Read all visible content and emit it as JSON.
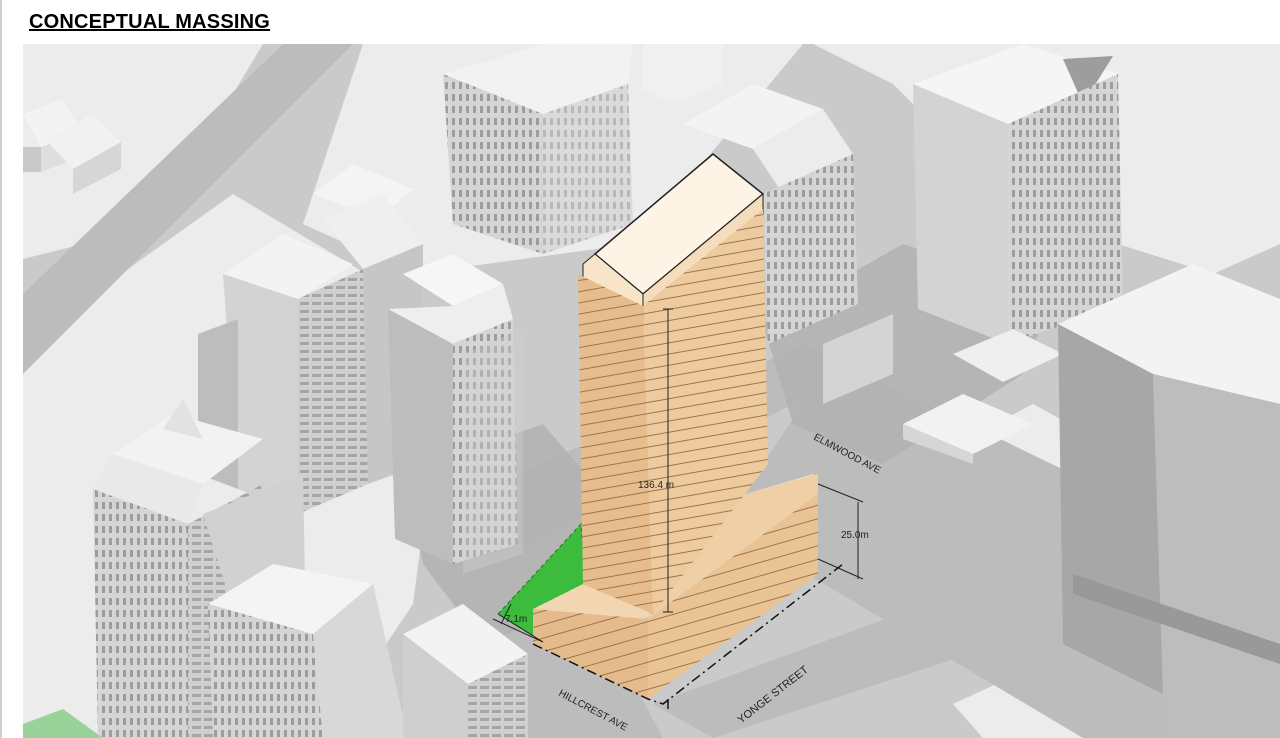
{
  "title": "CONCEPTUAL MASSING",
  "dimensions": {
    "tower_height": "136.4 m",
    "podium_height": "25.0m",
    "setback": "7.1m"
  },
  "streets": {
    "north": "ELMWOOD AVE",
    "east": "YONGE STREET",
    "south": "HILLCREST AVE"
  },
  "colors": {
    "proposed_tower": "#ecc69a",
    "proposed_podium": "#e8bd8e",
    "tower_top": "#fdf4e6",
    "open_space": "#3dbb3d",
    "context_buildings": "#d9d9d9",
    "road": "#bdbdbd",
    "block": "#ededed"
  }
}
